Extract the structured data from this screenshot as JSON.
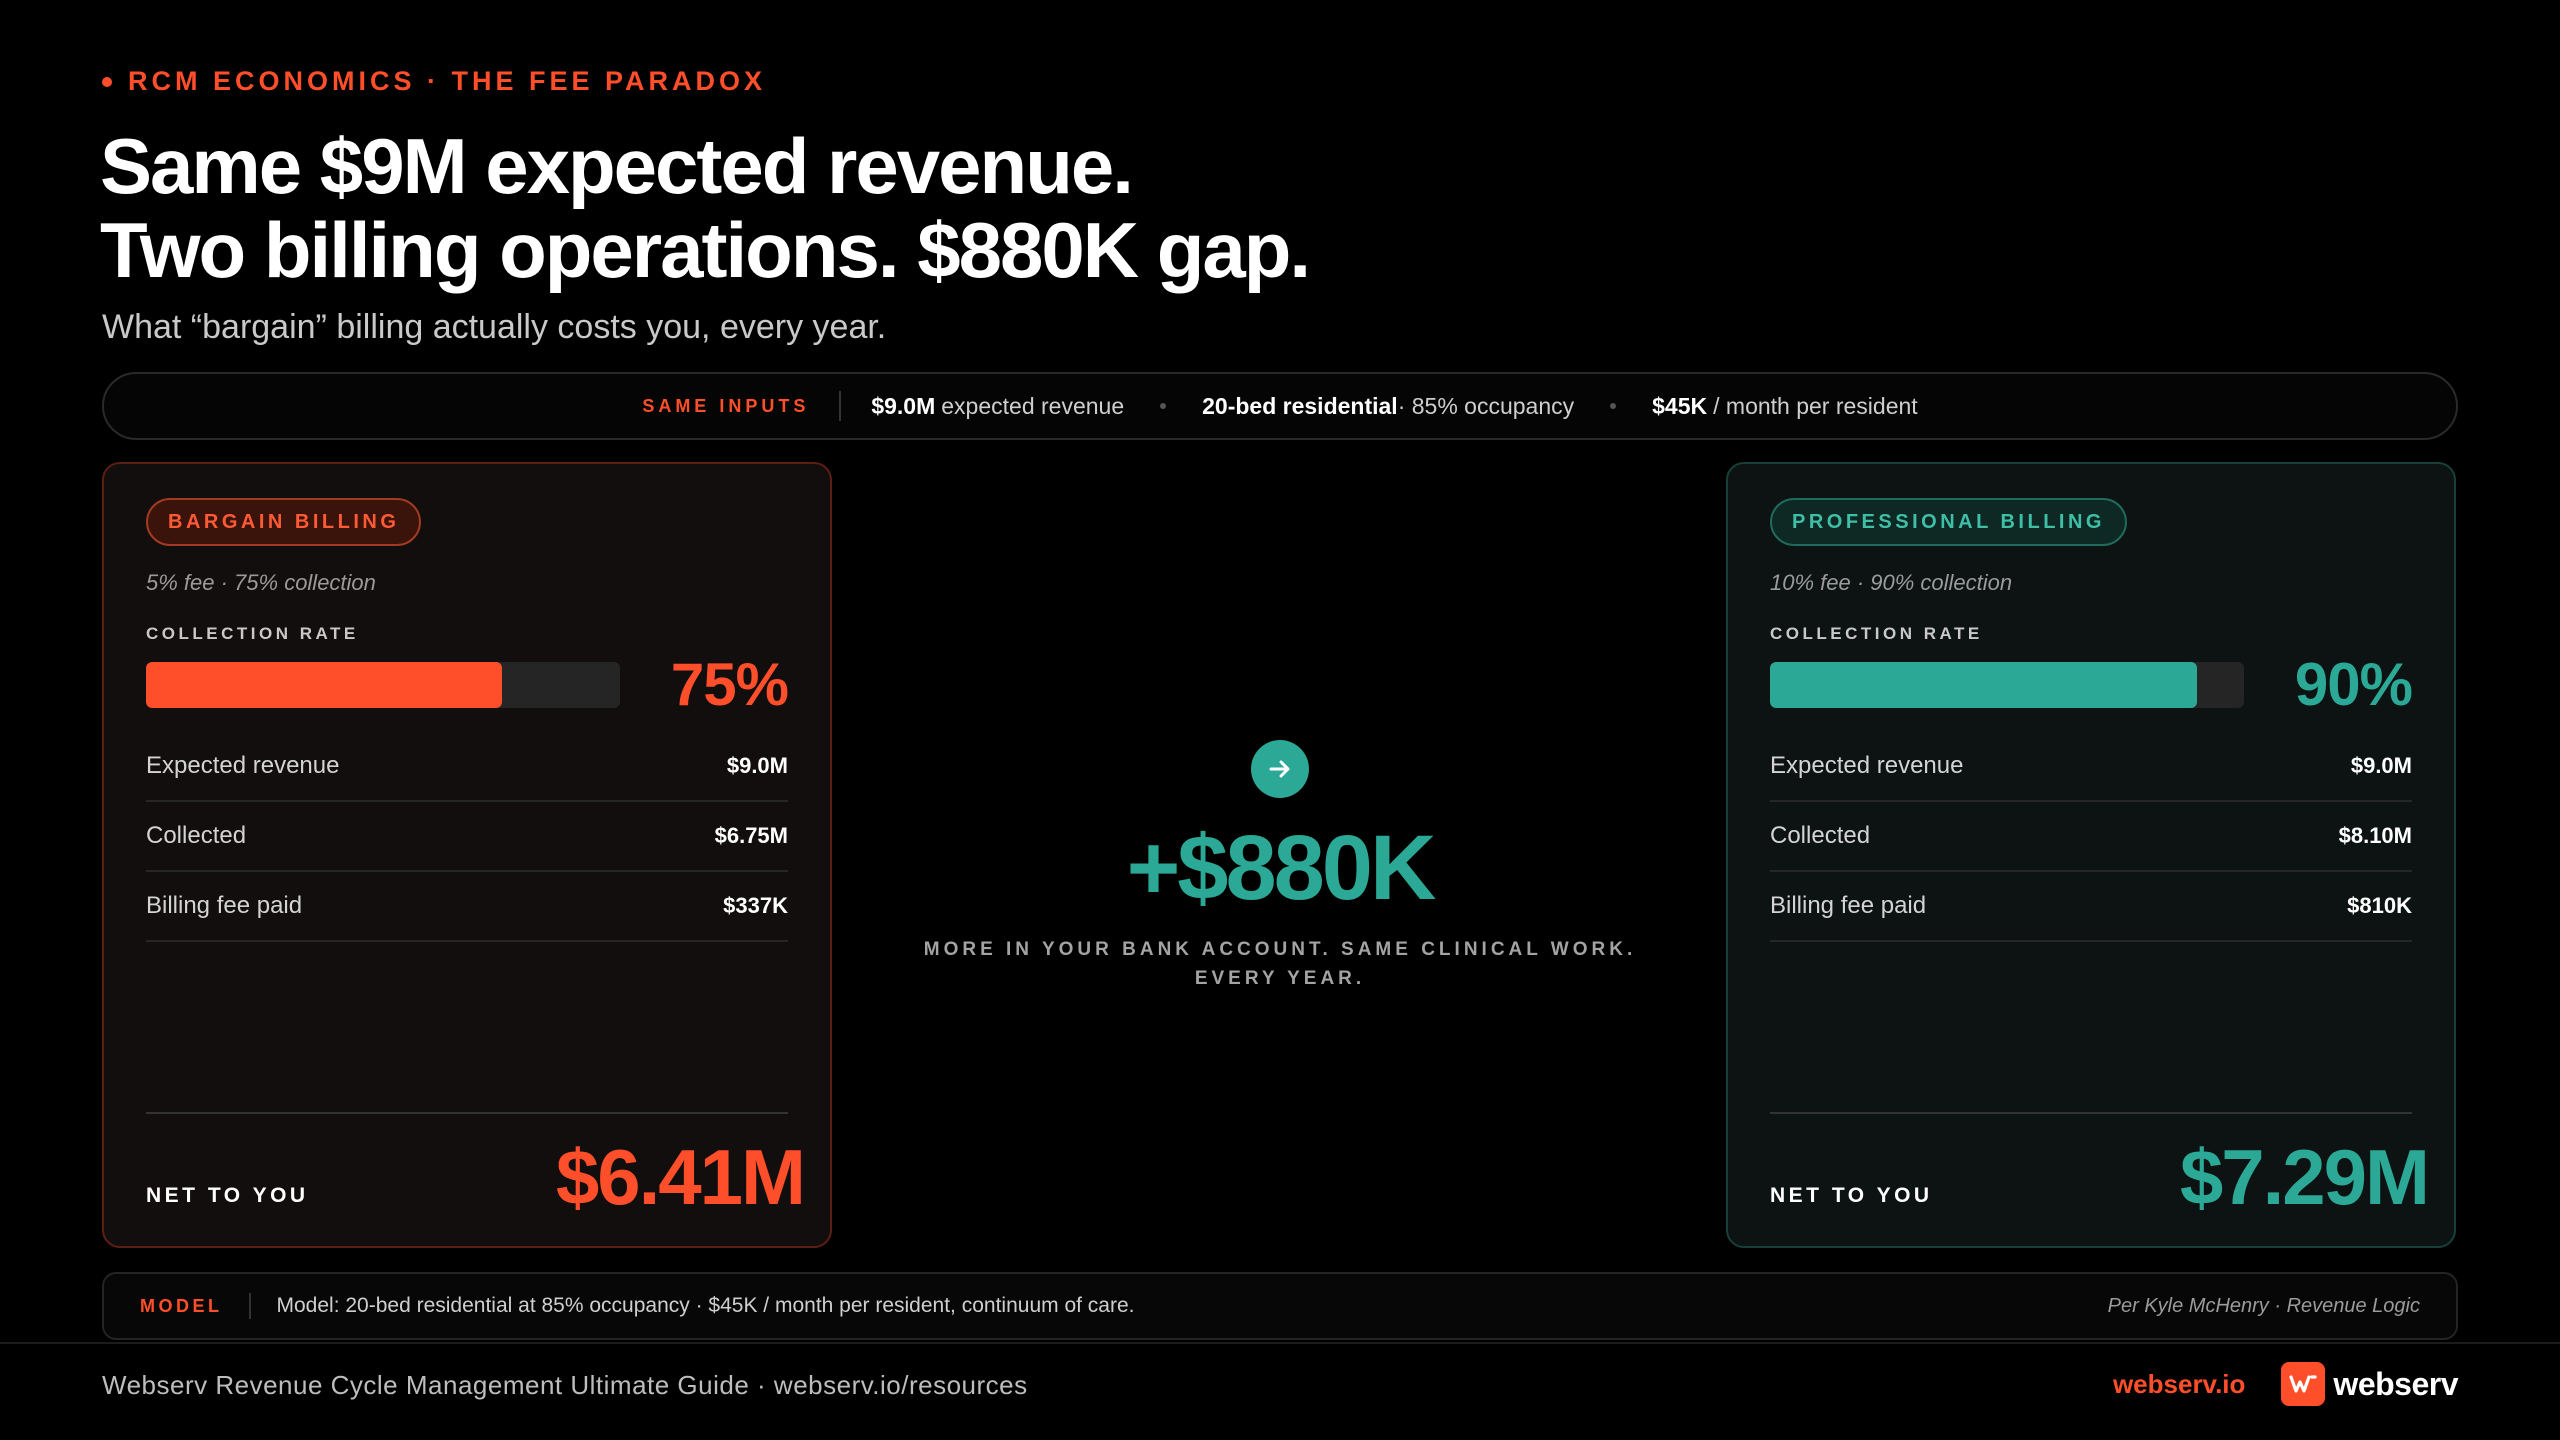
{
  "header": {
    "eyebrow": "RCM ECONOMICS · THE FEE PARADOX",
    "headline_line1": "Same $9M expected revenue.",
    "headline_line2": "Two billing operations. $880K gap.",
    "subhead": "What “bargain” billing actually costs you, every year."
  },
  "inputs": {
    "tag": "SAME INPUTS",
    "revenue_bold": "$9.0M",
    "revenue_text": "expected revenue",
    "beds_bold": "20-bed residential",
    "beds_text": "· 85% occupancy",
    "rate_bold": "$45K",
    "rate_text": "/ month per resident"
  },
  "bargain": {
    "pill": "BARGAIN BILLING",
    "terms": "5% fee · 75% collection",
    "rate_label": "COLLECTION RATE",
    "rate_value": "75%",
    "rate_fraction": 0.75,
    "rows": [
      {
        "label": "Expected revenue",
        "value": "$9.0M"
      },
      {
        "label": "Collected",
        "value": "$6.75M"
      },
      {
        "label": "Billing fee paid",
        "value": "$337K"
      }
    ],
    "net_label": "NET TO YOU",
    "net_value": "$6.41M"
  },
  "professional": {
    "pill": "PROFESSIONAL BILLING",
    "terms": "10% fee · 90% collection",
    "rate_label": "COLLECTION RATE",
    "rate_value": "90%",
    "rate_fraction": 0.9,
    "rows": [
      {
        "label": "Expected revenue",
        "value": "$9.0M"
      },
      {
        "label": "Collected",
        "value": "$8.10M"
      },
      {
        "label": "Billing fee paid",
        "value": "$810K"
      }
    ],
    "net_label": "NET TO YOU",
    "net_value": "$7.29M"
  },
  "center": {
    "icon": "arrow-right-icon",
    "gap_value": "+$880K",
    "caption": "MORE IN YOUR BANK ACCOUNT. SAME CLINICAL WORK. EVERY YEAR."
  },
  "model": {
    "tag": "MODEL",
    "text": "Model: 20-bed residential at 85% occupancy · $45K / month per resident, continuum of care.",
    "credit": "Per Kyle McHenry · Revenue Logic"
  },
  "footer": {
    "text": "Webserv Revenue Cycle Management Ultimate Guide · webserv.io/resources",
    "site": "webserv.io",
    "logo_word": "webserv"
  },
  "colors": {
    "accent_red": "#ff4e2a",
    "accent_teal": "#2ba896",
    "background": "#000000"
  }
}
